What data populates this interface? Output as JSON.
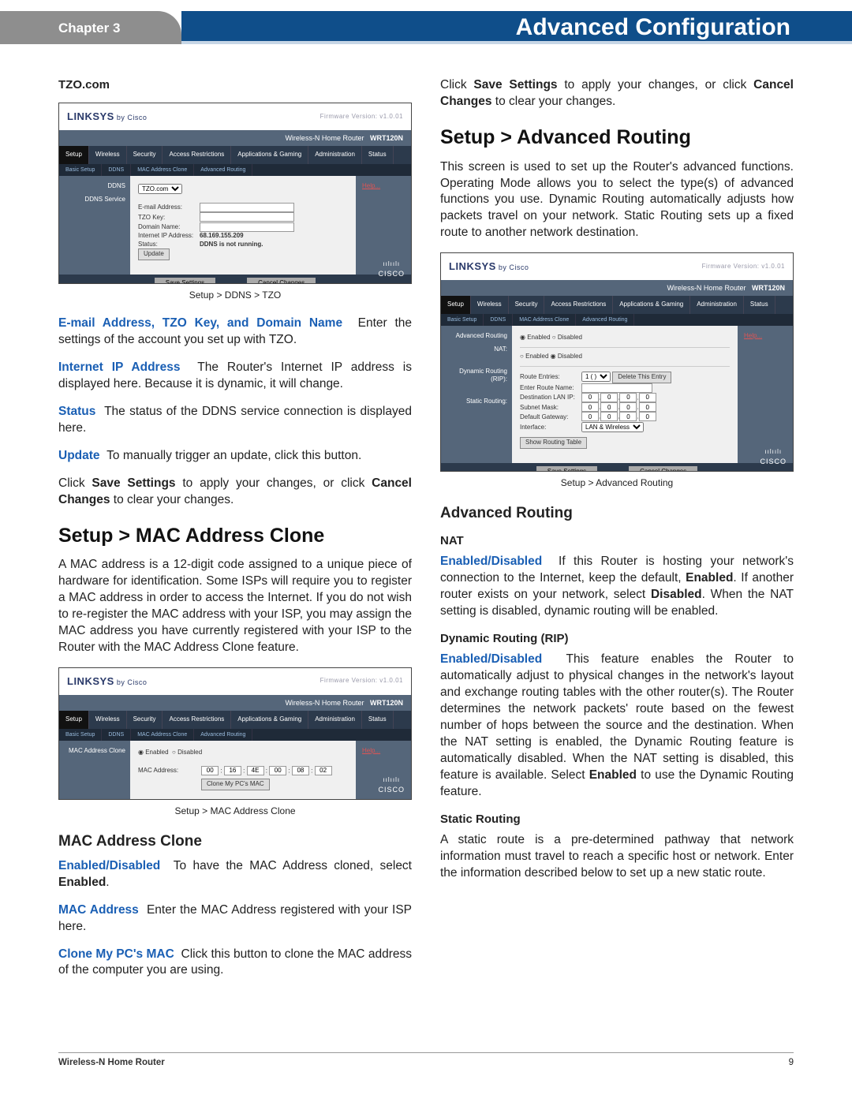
{
  "header": {
    "chapter": "Chapter 3",
    "title": "Advanced Configuration"
  },
  "footer": {
    "product": "Wireless-N Home Router",
    "page": "9"
  },
  "left": {
    "tzo_heading": "TZO.com",
    "fig1_caption": "Setup > DDNS > TZO",
    "p1": {
      "term": "E-mail Address, TZO Key, and Domain Name",
      "text": "Enter the settings of the account you set up with TZO."
    },
    "p2": {
      "term": "Internet IP Address",
      "text": "The Router's Internet IP address is displayed here. Because it is dynamic, it will change."
    },
    "p3": {
      "term": "Status",
      "text": "The status of the DDNS service connection is displayed here."
    },
    "p4": {
      "term": "Update",
      "text": "To manually trigger an update, click this button."
    },
    "p5": {
      "pre": "Click ",
      "b1": "Save Settings",
      "mid": " to apply your changes, or click ",
      "b2": "Cancel Changes",
      "post": " to clear your changes."
    },
    "mac_title": "Setup > MAC Address Clone",
    "mac_intro": "A MAC address is a 12-digit code assigned to a unique piece of hardware for identification. Some ISPs will require you to register a MAC address in order to access the Internet. If you do not wish to re-register the MAC address with your ISP, you may assign the MAC address you have currently registered with your ISP to the Router with the MAC Address Clone feature.",
    "fig2_caption": "Setup > MAC Address Clone",
    "mac_sub": "MAC Address Clone",
    "mp1": {
      "term": "Enabled/Disabled",
      "pre": "To have the MAC Address cloned, select ",
      "b": "Enabled",
      "post": "."
    },
    "mp2": {
      "term": "MAC Address",
      "text": "Enter the MAC Address registered with your ISP here."
    },
    "mp3": {
      "term": "Clone My PC's MAC",
      "text": "Click this button to clone the MAC address of the computer you are using."
    }
  },
  "right": {
    "p1": {
      "pre": "Click ",
      "b1": "Save Settings",
      "mid": " to apply your changes, or click ",
      "b2": "Cancel Changes",
      "post": " to clear your changes."
    },
    "ar_title": "Setup > Advanced Routing",
    "ar_intro": "This screen is used to set up the Router's advanced functions. Operating Mode allows you to select the type(s) of advanced functions you use. Dynamic Routing automatically adjusts how packets travel on your network. Static Routing sets up a fixed route to another network destination.",
    "fig3_caption": "Setup > Advanced Routing",
    "ar_sub": "Advanced Routing",
    "nat_h": "NAT",
    "nat_p": {
      "term": "Enabled/Disabled",
      "t1": "If this Router is hosting your network's connection to the Internet, keep the default, ",
      "b1": "Enabled",
      "t2": ". If another router exists on your network, select ",
      "b2": "Disabled",
      "t3": ". When the NAT setting is disabled, dynamic routing will be enabled."
    },
    "drip_h": "Dynamic Routing (RIP)",
    "drip_p": {
      "term": "Enabled/Disabled",
      "t1": "This feature enables the Router to automatically adjust to physical changes in the network's layout and exchange routing tables with the other router(s). The Router determines the network packets' route based on the fewest number of hops between the source and the destination. When the NAT setting is enabled, the Dynamic Routing feature is automatically disabled. When the NAT setting is disabled, this feature is available. Select ",
      "b1": "Enabled",
      "t2": " to use the Dynamic Routing feature."
    },
    "sr_h": "Static Routing",
    "sr_p": "A static route is a pre-determined pathway that network information must travel to reach a specific host or network. Enter the information described below to set up a new static route."
  },
  "router_common": {
    "brand": "LINKSYS",
    "by": "by Cisco",
    "fw": "Firmware Version: v1.0.01",
    "product": "Wireless-N Home Router",
    "model": "WRT120N",
    "tabs": [
      "Setup",
      "Wireless",
      "Security",
      "Access Restrictions",
      "Applications & Gaming",
      "Administration",
      "Status"
    ],
    "save": "Save Settings",
    "cancel": "Cancel Changes",
    "help": "Help...",
    "cisco": "CISCO"
  },
  "router1": {
    "side_tab": "Setup",
    "subtabs": [
      "Basic Setup",
      "|",
      "DDNS",
      "|",
      "MAC Address Clone",
      "|",
      "Advanced Routing"
    ],
    "side": [
      "DDNS",
      "DDNS Service"
    ],
    "service": "TZO.com",
    "rows": [
      "E-mail Address:",
      "TZO Key:",
      "Domain Name:",
      "Internet IP Address:",
      "Status:"
    ],
    "ip": "68.169.155.209",
    "status": "DDNS is not running.",
    "update": "Update"
  },
  "router2": {
    "side_tab": "Setup",
    "side": [
      "MAC Address Clone"
    ],
    "enabled": "Enabled",
    "disabled": "Disabled",
    "maclabel": "MAC Address:",
    "mac": [
      "00",
      "16",
      "4E",
      "00",
      "08",
      "02"
    ],
    "clonebtn": "Clone My PC's MAC"
  },
  "router3": {
    "side_tab": "Setup",
    "side": [
      "Advanced Routing",
      "NAT:",
      "",
      "Dynamic Routing (RIP):",
      "",
      "Static Routing:"
    ],
    "enabled": "Enabled",
    "disabled": "Disabled",
    "route_entries": "Route Entries:",
    "re_sel": "1 ( )",
    "delete": "Delete This Entry",
    "route_name": "Enter Route Name:",
    "dest": "Destination LAN IP:",
    "mask": "Subnet Mask:",
    "gw": "Default Gateway:",
    "iface": "Interface:",
    "iface_sel": "LAN & Wireless",
    "showbtn": "Show Routing Table",
    "zeros": [
      "0",
      "0",
      "0",
      "0"
    ]
  }
}
